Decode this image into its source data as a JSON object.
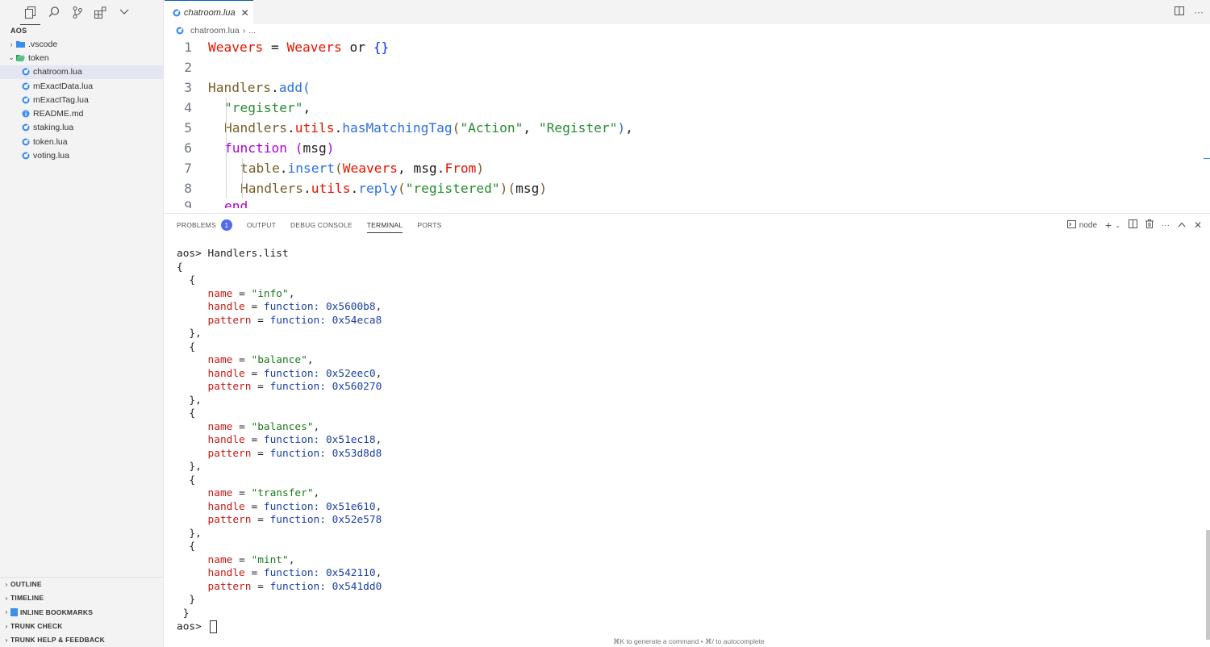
{
  "sidebar": {
    "activity_icons": [
      "explorer-icon",
      "search-icon",
      "source-control-icon",
      "extensions-icon",
      "chevron-down-icon"
    ],
    "section_title": "AOS",
    "tree": [
      {
        "label": ".vscode",
        "type": "folder",
        "expanded": false,
        "icon": "vscode-folder-icon"
      },
      {
        "label": "token",
        "type": "folder",
        "expanded": true,
        "icon": "folder-open-icon"
      },
      {
        "label": "chatroom.lua",
        "type": "file",
        "selected": true,
        "icon": "lua-file-icon"
      },
      {
        "label": "mExactData.lua",
        "type": "file",
        "icon": "lua-file-icon"
      },
      {
        "label": "mExactTag.lua",
        "type": "file",
        "icon": "lua-file-icon"
      },
      {
        "label": "README.md",
        "type": "file",
        "icon": "info-file-icon"
      },
      {
        "label": "staking.lua",
        "type": "file",
        "icon": "lua-file-icon"
      },
      {
        "label": "token.lua",
        "type": "file",
        "icon": "lua-file-icon"
      },
      {
        "label": "voting.lua",
        "type": "file",
        "icon": "lua-file-icon"
      }
    ],
    "bottom_panels": [
      "OUTLINE",
      "TIMELINE",
      "INLINE BOOKMARKS",
      "TRUNK CHECK",
      "TRUNK HELP & FEEDBACK"
    ]
  },
  "editor": {
    "tab_label": "chatroom.lua",
    "breadcrumb_file": "chatroom.lua",
    "breadcrumb_more": "...",
    "lines": [
      {
        "n": "1"
      },
      {
        "n": "2"
      },
      {
        "n": "3"
      },
      {
        "n": "4"
      },
      {
        "n": "5"
      },
      {
        "n": "6"
      },
      {
        "n": "7"
      },
      {
        "n": "8"
      },
      {
        "n": "9"
      }
    ],
    "code": {
      "l1_a": "Weavers",
      "l1_b": " = ",
      "l1_c": "Weavers",
      "l1_d": " or ",
      "l1_e": "{}",
      "l3_a": "Handlers",
      "l3_b": ".",
      "l3_c": "add",
      "l3_d": "(",
      "l4": "\"register\"",
      "l4_comma": ",",
      "l5_a": "Handlers",
      "l5_b": ".",
      "l5_c": "utils",
      "l5_d": ".",
      "l5_e": "hasMatchingTag",
      "l5_f": "(",
      "l5_g": "\"Action\"",
      "l5_h": ", ",
      "l5_i": "\"Register\"",
      "l5_j": ")",
      "l5_k": ",",
      "l6_a": "function",
      "l6_b": " (",
      "l6_c": "msg",
      "l6_d": ")",
      "l7_a": "table",
      "l7_b": ".",
      "l7_c": "insert",
      "l7_d": "(",
      "l7_e": "Weavers",
      "l7_f": ", msg.",
      "l7_g": "From",
      "l7_h": ")",
      "l8_a": "Handlers",
      "l8_b": ".",
      "l8_c": "utils",
      "l8_d": ".",
      "l8_e": "reply",
      "l8_f": "(",
      "l8_g": "\"registered\"",
      "l8_h": ")(",
      "l8_i": "msg",
      "l8_j": ")",
      "l9": "end"
    }
  },
  "panel": {
    "tabs": [
      {
        "label": "PROBLEMS",
        "badge": "1"
      },
      {
        "label": "OUTPUT"
      },
      {
        "label": "DEBUG CONSOLE"
      },
      {
        "label": "TERMINAL",
        "active": true
      },
      {
        "label": "PORTS"
      }
    ],
    "terminal_name": "node",
    "prompt": "aos> ",
    "command": "Handlers.list",
    "handlers": [
      {
        "name": "\"info\"",
        "handle": "0x5600b8",
        "pattern": "0x54eca8"
      },
      {
        "name": "\"balance\"",
        "handle": "0x52eec0",
        "pattern": "0x560270"
      },
      {
        "name": "\"balances\"",
        "handle": "0x51ec18",
        "pattern": "0x53d8d8"
      },
      {
        "name": "\"transfer\"",
        "handle": "0x51e610",
        "pattern": "0x52e578"
      },
      {
        "name": "\"mint\"",
        "handle": "0x542110",
        "pattern": "0x541dd0"
      }
    ],
    "kw_name": "name",
    "kw_handle": "handle",
    "kw_pattern": "pattern",
    "kw_function": "function:",
    "hint": "⌘K to generate a command • ⌘/ to autocomplete"
  }
}
